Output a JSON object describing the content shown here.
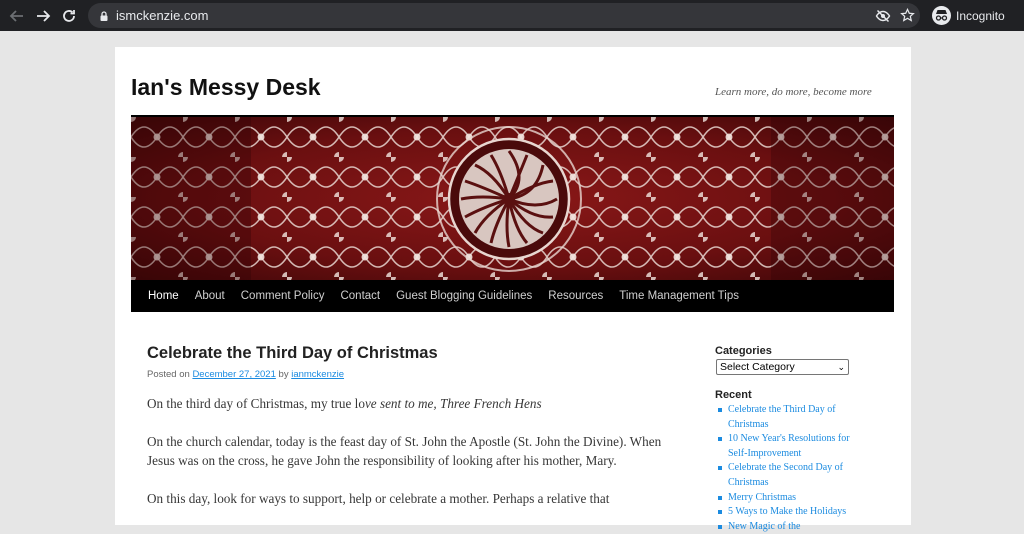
{
  "browser": {
    "url": "ismckenzie.com",
    "mode_label": "Incognito"
  },
  "site": {
    "title": "Ian's Messy Desk",
    "tagline": "Learn more, do more, become more"
  },
  "menu": {
    "items": [
      "Home",
      "About",
      "Comment Policy",
      "Contact",
      "Guest Blogging Guidelines",
      "Resources",
      "Time Management Tips"
    ]
  },
  "post": {
    "title": "Celebrate the Third Day of Christmas",
    "meta_prefix": "Posted on",
    "date": "December 27, 2021",
    "meta_by": "by",
    "author": "ianmckenzie",
    "p1_plain": "On the third day of Christmas, my true lo",
    "p1_italic": "ve sent to me, Three French Hens",
    "p2": "On the church calendar, today is the feast day of St. John the Apostle (St. John the Divine). When Jesus was on the cross, he gave John the responsibility of looking after his mother, Mary.",
    "p3": "On this day, look for ways to support, help or celebrate a mother. Perhaps a relative that"
  },
  "sidebar": {
    "categories_title": "Categories",
    "categories_select": "Select Category",
    "recent_title": "Recent",
    "recent": [
      "Celebrate the Third Day of Christmas",
      "10 New Year's Resolutions for Self-Improvement",
      "Celebrate the Second Day of Christmas",
      "Merry Christmas",
      "5 Ways to Make the Holidays",
      "New Magic of the"
    ]
  },
  "colors": {
    "chrome_bg": "#202124",
    "link": "#1b8be0",
    "menu_bg": "#000000",
    "banner_red": "#7a1212"
  }
}
